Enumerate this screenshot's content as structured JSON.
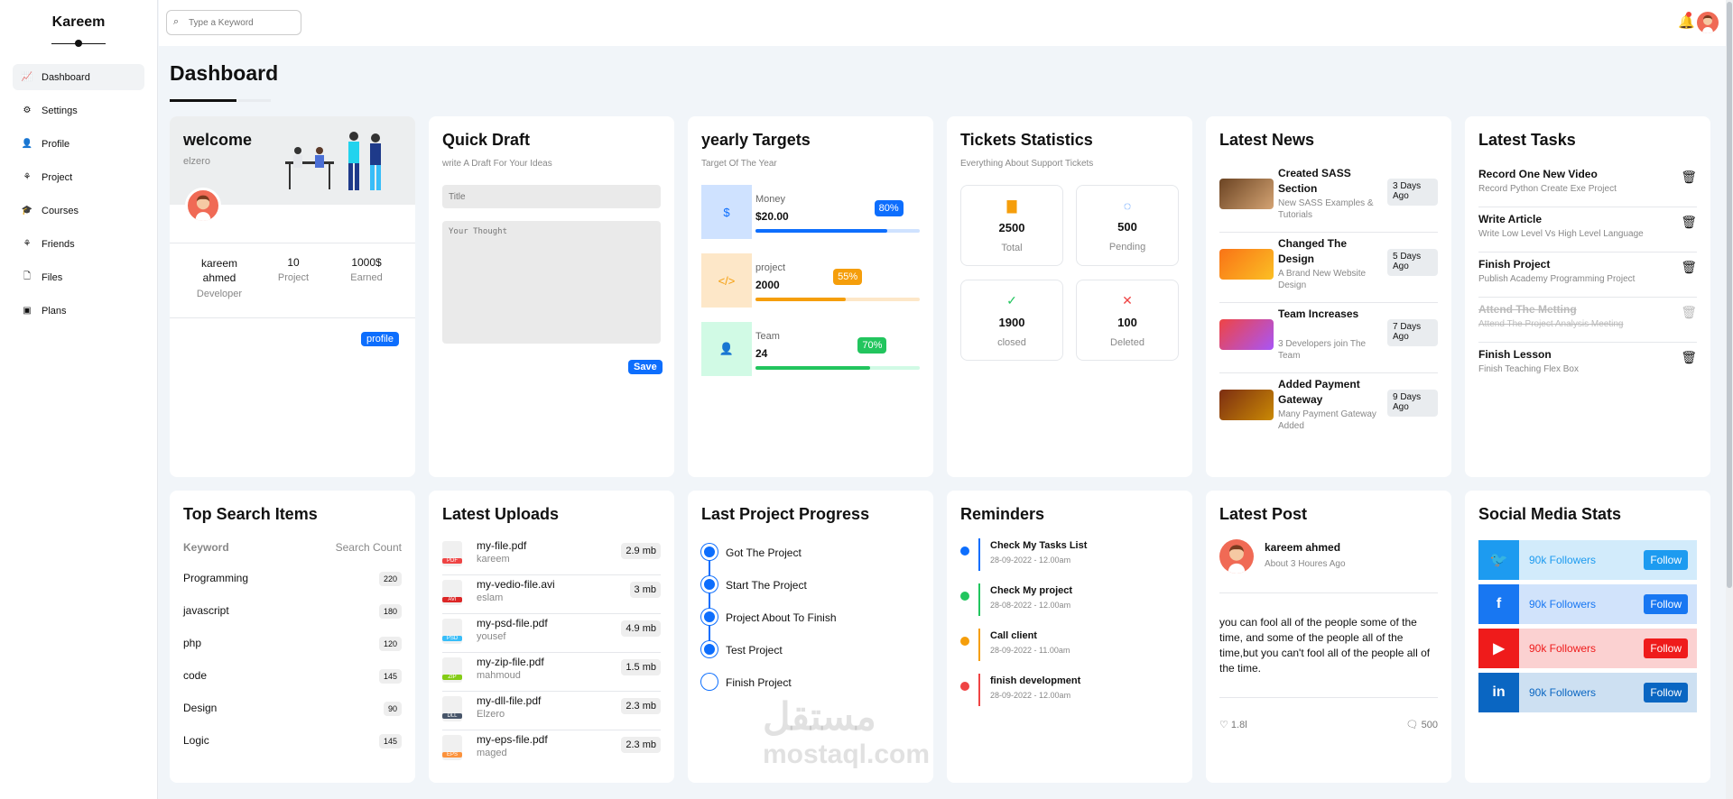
{
  "sidebar": {
    "brand": "Kareem",
    "items": [
      {
        "label": "Dashboard",
        "icon": "chart-icon"
      },
      {
        "label": "Settings",
        "icon": "gear-icon"
      },
      {
        "label": "Profile",
        "icon": "user-icon"
      },
      {
        "label": "Project",
        "icon": "project-icon"
      },
      {
        "label": "Courses",
        "icon": "graduation-icon"
      },
      {
        "label": "Friends",
        "icon": "friends-icon"
      },
      {
        "label": "Files",
        "icon": "file-icon"
      },
      {
        "label": "Plans",
        "icon": "calendar-icon"
      }
    ]
  },
  "header": {
    "search_placeholder": "Type a Keyword"
  },
  "page": {
    "title": "Dashboard"
  },
  "welcome": {
    "title": "welcome",
    "subtitle": "elzero",
    "name": "kareem ahmed",
    "role": "Developer",
    "projects": "10",
    "projects_label": "Project",
    "earned": "1000$",
    "earned_label": "Earned",
    "button": "profile"
  },
  "draft": {
    "title": "Quick Draft",
    "subtitle": "write A Draft For Your Ideas",
    "title_placeholder": "Title",
    "body_placeholder": "Your Thought",
    "button": "Save"
  },
  "targets": {
    "title": "yearly Targets",
    "subtitle": "Target Of The Year",
    "items": [
      {
        "label": "Money",
        "value": "$20.00",
        "percent": "80%",
        "progress": 80,
        "color": "#0d6efd",
        "icon": "dollar-icon",
        "glyph": "$"
      },
      {
        "label": "project",
        "value": "2000",
        "percent": "55%",
        "progress": 55,
        "color": "#f59e0b",
        "icon": "code-icon",
        "glyph": "</>"
      },
      {
        "label": "Team",
        "value": "24",
        "percent": "70%",
        "progress": 70,
        "color": "#22c55e",
        "icon": "user-icon",
        "glyph": "👤"
      }
    ]
  },
  "tickets": {
    "title": "Tickets Statistics",
    "subtitle": "Everything About Support Tickets",
    "items": [
      {
        "num": "2500",
        "label": "Total",
        "icon": "folder-icon",
        "color": "#f59e0b",
        "glyph": "▇"
      },
      {
        "num": "500",
        "label": "Pending",
        "icon": "spinner-icon",
        "color": "#0d6efd",
        "glyph": "◌"
      },
      {
        "num": "1900",
        "label": "closed",
        "icon": "check-circle-icon",
        "color": "#22c55e",
        "glyph": "✓"
      },
      {
        "num": "100",
        "label": "Deleted",
        "icon": "x-circle-icon",
        "color": "#ef4444",
        "glyph": "✕"
      }
    ]
  },
  "news": {
    "title": "Latest News",
    "items": [
      {
        "title": "Created SASS Section",
        "desc": "New SASS Examples & Tutorials",
        "ago": "3 Days Ago"
      },
      {
        "title": "Changed The Design",
        "desc": "A Brand New Website Design",
        "ago": "5 Days Ago"
      },
      {
        "title": "Team Increases",
        "desc": "3 Developers join The Team",
        "ago": "7 Days Ago"
      },
      {
        "title": "Added Payment Gateway",
        "desc": "Many Payment Gateway Added",
        "ago": "9 Days Ago"
      }
    ]
  },
  "tasks": {
    "title": "Latest Tasks",
    "items": [
      {
        "title": "Record One New Video",
        "desc": "Record Python Create Exe Project",
        "done": false
      },
      {
        "title": "Write Article",
        "desc": "Write Low Level Vs High Level Language",
        "done": false
      },
      {
        "title": "Finish Project",
        "desc": "Publish Academy Programming Project",
        "done": false
      },
      {
        "title": "Attend The Metting",
        "desc": "Attend The Project Analysis Meeting",
        "done": true
      },
      {
        "title": "Finish Lesson",
        "desc": "Finish Teaching Flex Box",
        "done": false
      }
    ]
  },
  "search_items": {
    "title": "Top Search Items",
    "col_keyword": "Keyword",
    "col_count": "Search Count",
    "rows": [
      {
        "keyword": "Programming",
        "count": "220"
      },
      {
        "keyword": "javascript",
        "count": "180"
      },
      {
        "keyword": "php",
        "count": "120"
      },
      {
        "keyword": "code",
        "count": "145"
      },
      {
        "keyword": "Design",
        "count": "90"
      },
      {
        "keyword": "Logic",
        "count": "145"
      }
    ]
  },
  "uploads": {
    "title": "Latest Uploads",
    "items": [
      {
        "name": "my-file.pdf",
        "owner": "kareem",
        "size": "2.9 mb",
        "ext": "PDF",
        "color": "#ef4444"
      },
      {
        "name": "my-vedio-file.avi",
        "owner": "eslam",
        "size": "3 mb",
        "ext": "AVI",
        "color": "#dc2626"
      },
      {
        "name": "my-psd-file.pdf",
        "owner": "yousef",
        "size": "4.9 mb",
        "ext": "PSD",
        "color": "#38bdf8"
      },
      {
        "name": "my-zip-file.pdf",
        "owner": "mahmoud",
        "size": "1.5 mb",
        "ext": "ZIP",
        "color": "#84cc16"
      },
      {
        "name": "my-dll-file.pdf",
        "owner": "Elzero",
        "size": "2.3 mb",
        "ext": "DLL",
        "color": "#475569"
      },
      {
        "name": "my-eps-file.pdf",
        "owner": "maged",
        "size": "2.3 mb",
        "ext": "EPS",
        "color": "#fb923c"
      }
    ]
  },
  "progress": {
    "title": "Last Project Progress",
    "steps": [
      {
        "label": "Got The Project",
        "done": true
      },
      {
        "label": "Start The Project",
        "done": true
      },
      {
        "label": "Project About To Finish",
        "done": true
      },
      {
        "label": "Test Project",
        "done": true
      },
      {
        "label": "Finish Project",
        "done": false
      }
    ]
  },
  "reminders": {
    "title": "Reminders",
    "items": [
      {
        "title": "Check My Tasks List",
        "date": "28-09-2022 - 12.00am",
        "color": "#0d6efd"
      },
      {
        "title": "Check My project",
        "date": "28-08-2022 - 12.00am",
        "color": "#22c55e"
      },
      {
        "title": "Call client",
        "date": "28-09-2022 - 11.00am",
        "color": "#f59e0b"
      },
      {
        "title": "finish development",
        "date": "28-09-2022 - 12.00am",
        "color": "#ef4444"
      }
    ]
  },
  "post": {
    "title": "Latest Post",
    "author": "kareem ahmed",
    "time": "About 3 Houres Ago",
    "body": "you can fool all of the people some of the time, and some of the people all of the time,but you can't fool all of the people all of the time.",
    "likes": "1.8l",
    "comments": "500"
  },
  "social": {
    "title": "Social Media Stats",
    "items": [
      {
        "icon": "twitter-icon",
        "followers": "90k Followers",
        "button": "Follow",
        "color": "#1d9bf0",
        "light": "#d2ebfb"
      },
      {
        "icon": "facebook-icon",
        "followers": "90k Followers",
        "button": "Follow",
        "color": "#1877f2",
        "light": "#d1e3fb"
      },
      {
        "icon": "youtube-icon",
        "followers": "90k Followers",
        "button": "Follow",
        "color": "#ef1b1b",
        "light": "#fbd1d1"
      },
      {
        "icon": "linkedin-icon",
        "followers": "90k Followers",
        "button": "Follow",
        "color": "#0a66c2",
        "light": "#cde0f2"
      }
    ]
  },
  "watermark": {
    "arabic": "مستقل",
    "latin": "mostaql.com"
  }
}
